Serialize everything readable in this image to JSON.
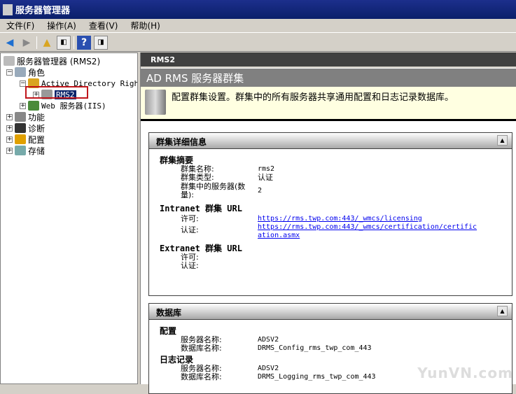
{
  "window": {
    "title": "服务器管理器"
  },
  "menu": [
    "文件(F)",
    "操作(A)",
    "查看(V)",
    "帮助(H)"
  ],
  "tree": {
    "root": "服务器管理器 (RMS2)",
    "roles": "角色",
    "adrms": "Active Directory Right",
    "rms2": "RMS2",
    "iis": "Web 服务器(IIS)",
    "features": "功能",
    "diagnostics": "诊断",
    "configuration": "配置",
    "storage": "存储"
  },
  "content": {
    "header": "RMS2",
    "title": "AD RMS 服务器群集",
    "description": "配置群集设置。群集中的所有服务器共享通用配置和日志记录数据库。",
    "cluster_panel": {
      "title": "群集详细信息",
      "summary_heading": "群集摘要",
      "name_label": "群集名称:",
      "name_value": "rms2",
      "type_label": "群集类型:",
      "type_value": "认证",
      "count_label": "群集中的服务器(数量):",
      "count_value": "2",
      "intranet_heading": "Intranet 群集 URL",
      "licensing_label": "许可:",
      "licensing_url": "https://rms.twp.com:443/_wmcs/licensing",
      "cert_label": "认证:",
      "cert_url": "https://rms.twp.com:443/_wmcs/certification/certification.asmx",
      "extranet_heading": "Extranet 群集 URL",
      "ext_licensing_label": "许可:",
      "ext_cert_label": "认证:"
    },
    "db_panel": {
      "title": "数据库",
      "config_heading": "配置",
      "config_server_label": "服务器名称:",
      "config_server": "ADSV2",
      "config_db_label": "数据库名称:",
      "config_db": "DRMS_Config_rms_twp_com_443",
      "log_heading": "日志记录",
      "log_server_label": "服务器名称:",
      "log_server": "ADSV2",
      "log_db_label": "数据库名称:",
      "log_db": "DRMS_Logging_rms_twp_com_443"
    }
  },
  "watermark": "YunVN.com"
}
